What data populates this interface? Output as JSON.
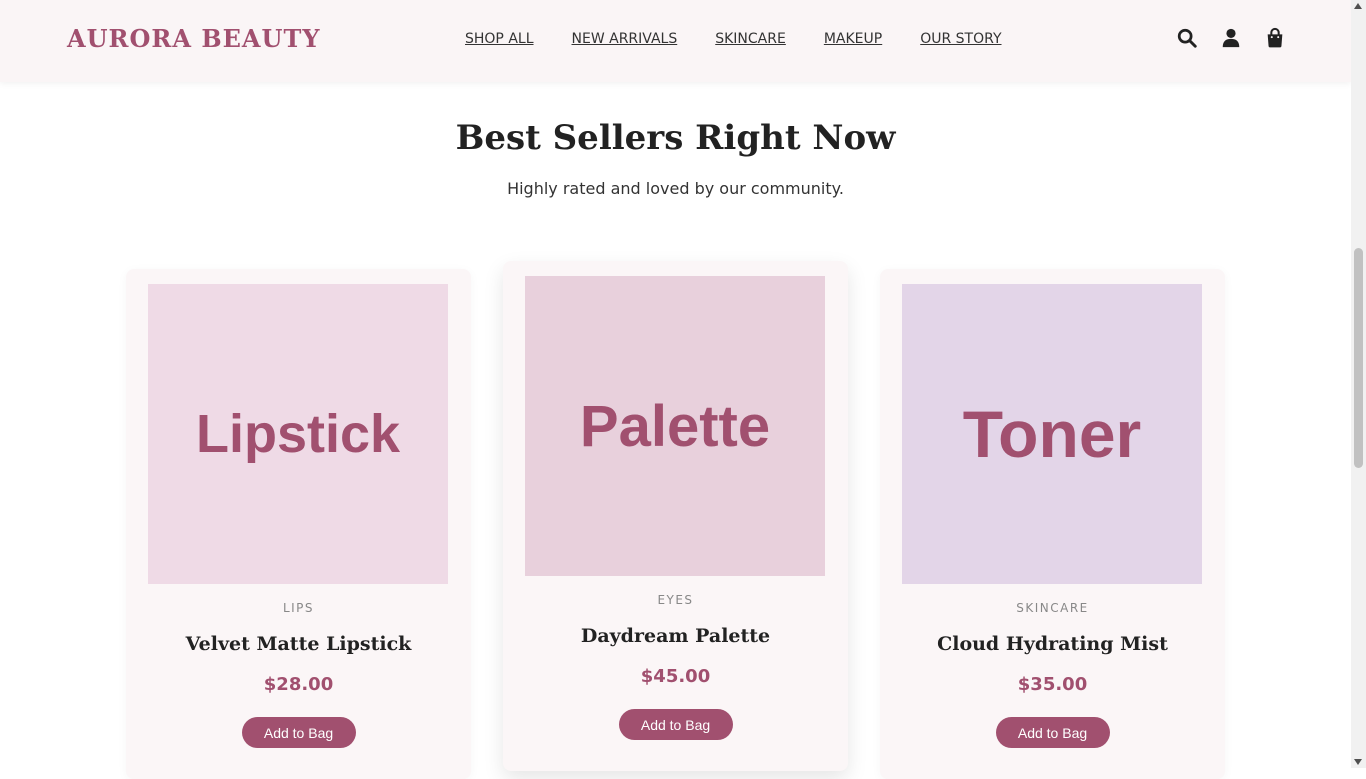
{
  "header": {
    "logo": "AURORA BEAUTY",
    "nav": [
      "SHOP ALL",
      "NEW ARRIVALS",
      "SKINCARE",
      "MAKEUP",
      "OUR STORY"
    ],
    "icons": [
      "search-icon",
      "account-icon",
      "bag-icon"
    ]
  },
  "section": {
    "title": "Best Sellers Right Now",
    "subtitle": "Highly rated and loved by our community."
  },
  "products": [
    {
      "image_text": "Lipstick",
      "image_bg": "#efdae6",
      "category": "LIPS",
      "name": "Velvet Matte Lipstick",
      "price": "$28.00",
      "button": "Add to Bag"
    },
    {
      "image_text": "Palette",
      "image_bg": "#e8d0dc",
      "category": "EYES",
      "name": "Daydream Palette",
      "price": "$45.00",
      "button": "Add to Bag"
    },
    {
      "image_text": "Toner",
      "image_bg": "#e3d5e8",
      "category": "SKINCARE",
      "name": "Cloud Hydrating Mist",
      "price": "$35.00",
      "button": "Add to Bag"
    }
  ],
  "colors": {
    "accent": "#a1506f",
    "header_bg": "#faf5f6",
    "card_bg": "#fbf6f7"
  }
}
